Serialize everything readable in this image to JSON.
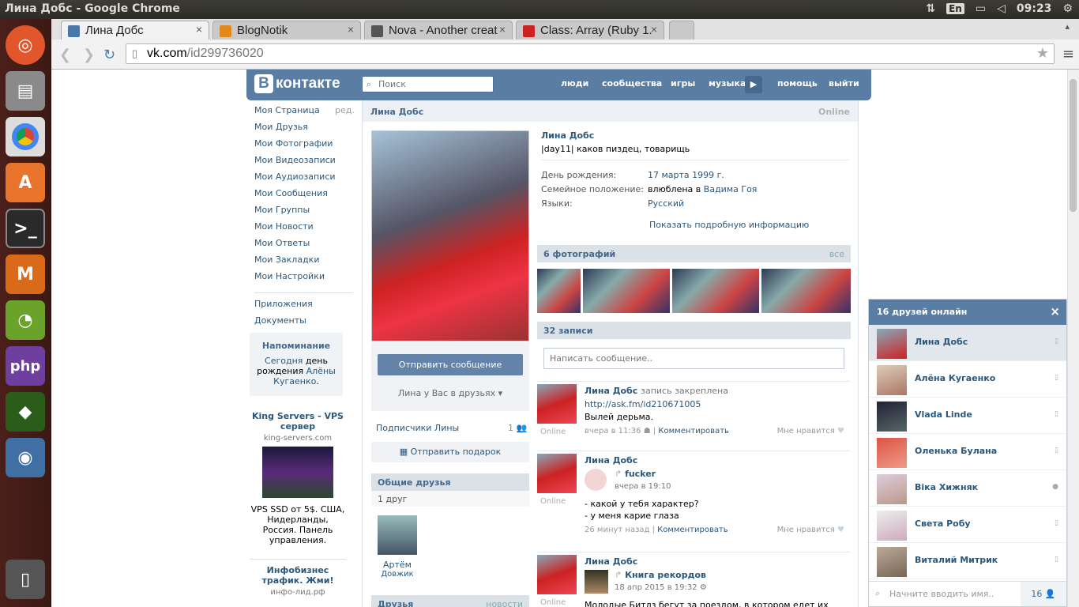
{
  "os": {
    "window_title": "Лина Добс - Google Chrome",
    "lang": "En",
    "time": "09:23"
  },
  "tabs": [
    {
      "label": "Лина Добс",
      "color": "#4a76a8"
    },
    {
      "label": "BlogNotik",
      "color": "#e08a1e"
    },
    {
      "label": "Nova - Another creat",
      "color": "#333333"
    },
    {
      "label": "Class: Array (Ruby 1.",
      "color": "#cc2222"
    }
  ],
  "address": {
    "domain": "vk.com",
    "path": "/id299736020"
  },
  "vk": {
    "logo_text": "контакте",
    "logo_b": "B",
    "search_placeholder": "Поиск",
    "nav": [
      "люди",
      "сообщества",
      "игры",
      "музыка",
      "помощь",
      "выйти"
    ],
    "left_menu": [
      "Моя Страница",
      "Мои Друзья",
      "Мои Фотографии",
      "Мои Видеозаписи",
      "Мои Аудиозаписи",
      "Мои Сообщения",
      "Мои Группы",
      "Мои Новости",
      "Мои Ответы",
      "Мои Закладки",
      "Мои Настройки"
    ],
    "edit_label": "ред.",
    "extra_menu": [
      "Приложения",
      "Документы"
    ],
    "reminder": {
      "title": "Напоминание",
      "today": "Сегодня",
      "text1": "день рождения",
      "person": "Алёны Кугаенко",
      "dot": "."
    },
    "ad1": {
      "title": "King Servers - VPS сервер",
      "domain": "king-servers.com",
      "text": "VPS SSD от 5$. США, Нидерланды, Россия. Панель управления."
    },
    "ad2": {
      "title": "Инфобизнес трафик. Жми!",
      "domain": "инфо-лид.рф"
    }
  },
  "profile": {
    "header_name": "Лина Добс",
    "online": "Online",
    "name": "Лина Добс",
    "status": "|day11| каков пиздец, товарищь",
    "birthday_label": "День рождения:",
    "birthday": "17 марта 1999 г.",
    "family_label": "Семейное положение:",
    "family_prefix": "влюблена в",
    "family_person": "Вадима Гоя",
    "lang_label": "Языки:",
    "lang_value": "Русский",
    "show_more": "Показать подробную информацию",
    "send_message": "Отправить сообщение",
    "in_friends": "Лина у Вас в друзьях",
    "subscribers": "Подписчики Лины",
    "subscribers_count": "1",
    "gift": "Отправить подарок",
    "common_friends": "Общие друзья",
    "common_count": "1 друг",
    "friend_name": "Артём",
    "friend_surname": "Довжик",
    "friends_section": "Друзья",
    "friends_news": "новости",
    "photos_label": "6 фотографий",
    "photos_all": "все",
    "posts_label": "32 записи",
    "compose_placeholder": "Написать сообщение.."
  },
  "posts": [
    {
      "author": "Лина Добс",
      "pinned": "запись закреплена",
      "link": "http://ask.fm/id210671005",
      "text": "Вылей дерьма.",
      "online": "Online",
      "time": "вчера в 11:36",
      "action": "Комментировать",
      "like": "Мне нравится"
    },
    {
      "author": "Лина Добс",
      "repost": "fucker",
      "repost_time": "вчера в 19:10",
      "line1": "- какой у тебя характер?",
      "line2": "- у меня карие глаза",
      "online": "Online",
      "time": "26 минут назад",
      "action": "Комментировать",
      "like": "Мне нравится"
    },
    {
      "author": "Лина Добс",
      "repost": "Книга рекордов",
      "repost_time": "18 апр 2015 в 19:32",
      "text": "Молодые Битлз бегут за поездом, в котором едет их кумир -",
      "online": "Online"
    }
  ],
  "chat": {
    "title": "16 друзей онлайн",
    "friends": [
      {
        "name": "Лина Добс"
      },
      {
        "name": "Алёна Кугаенко"
      },
      {
        "name": "Vlada Linde"
      },
      {
        "name": "Оленька Булана"
      },
      {
        "name": "Віка Хижняк"
      },
      {
        "name": "Света Робу"
      },
      {
        "name": "Виталий Митрик"
      }
    ],
    "search_placeholder": "Начните вводить имя..",
    "count": "16"
  }
}
